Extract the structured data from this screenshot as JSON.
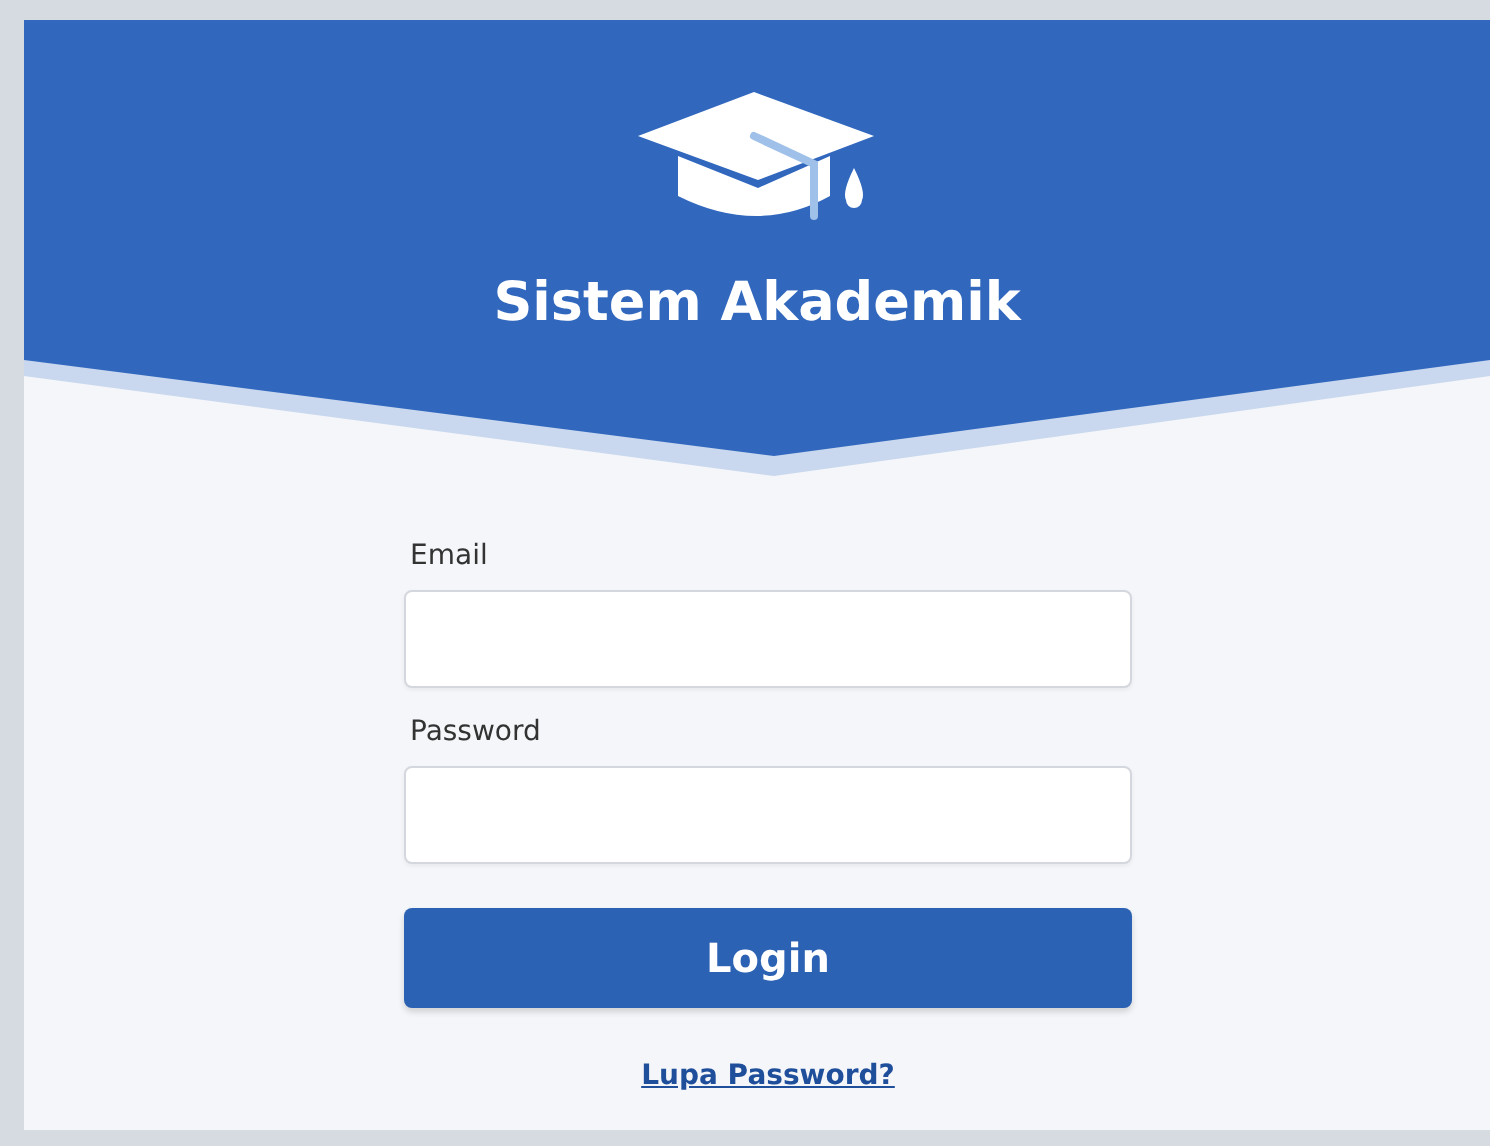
{
  "header": {
    "title": "Sistem Akademik"
  },
  "form": {
    "fields": [
      {
        "label": "Email"
      },
      {
        "label": "Password"
      }
    ],
    "submit": "Login",
    "link": "Lupa Password?"
  }
}
